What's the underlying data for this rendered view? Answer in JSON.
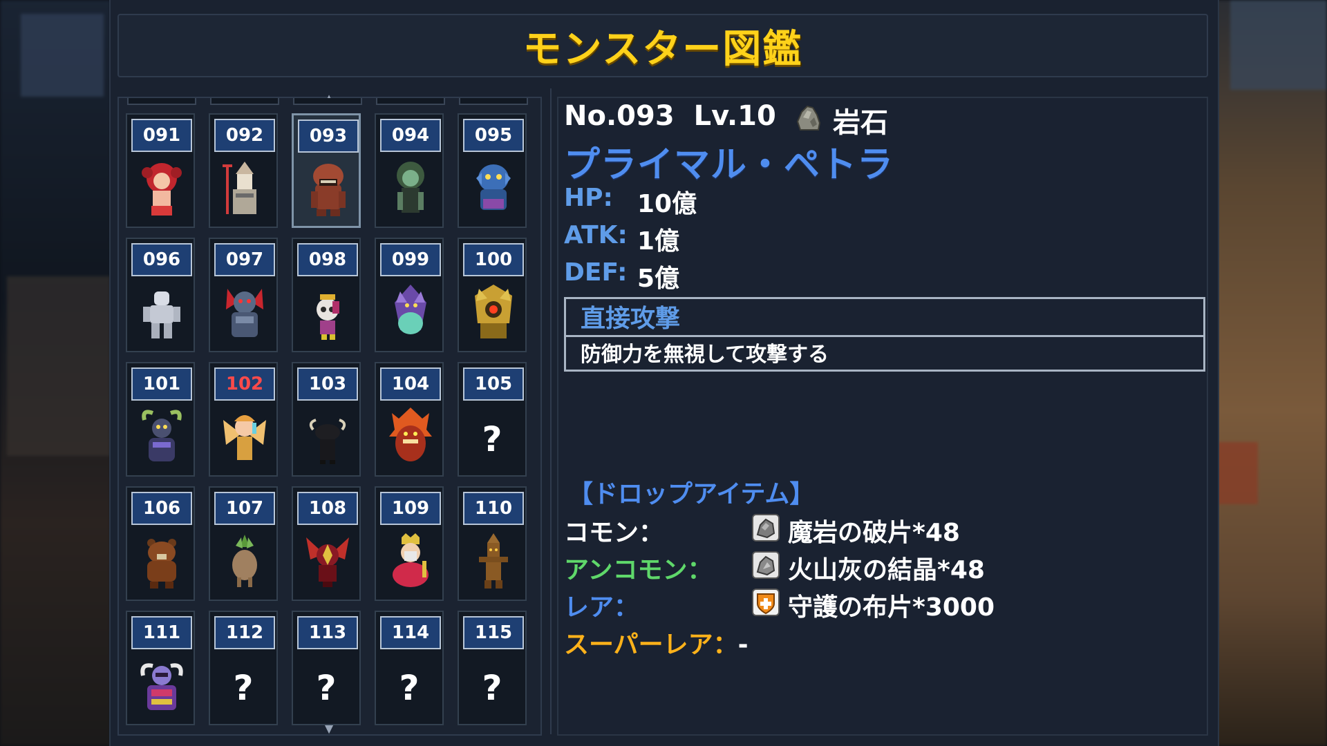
{
  "title": "モンスター図鑑",
  "grid": {
    "cells": [
      {
        "num": "091",
        "known": true,
        "red": false,
        "sprite": "red-haired-girl"
      },
      {
        "num": "092",
        "known": true,
        "red": false,
        "sprite": "trident-knight"
      },
      {
        "num": "093",
        "known": true,
        "red": false,
        "sprite": "rock-golem",
        "selected": true
      },
      {
        "num": "094",
        "known": true,
        "red": false,
        "sprite": "green-lady"
      },
      {
        "num": "095",
        "known": true,
        "red": false,
        "sprite": "blue-fish-man"
      },
      {
        "num": "096",
        "known": true,
        "red": false,
        "sprite": "white-golem"
      },
      {
        "num": "097",
        "known": true,
        "red": false,
        "sprite": "demon-red-hair"
      },
      {
        "num": "098",
        "known": true,
        "red": false,
        "sprite": "skull-girl"
      },
      {
        "num": "099",
        "known": true,
        "red": false,
        "sprite": "purple-dragon"
      },
      {
        "num": "100",
        "known": true,
        "red": false,
        "sprite": "golden-beast"
      },
      {
        "num": "101",
        "known": true,
        "red": false,
        "sprite": "horned-witch"
      },
      {
        "num": "102",
        "known": true,
        "red": true,
        "sprite": "winged-angel"
      },
      {
        "num": "103",
        "known": true,
        "red": false,
        "sprite": "black-bull"
      },
      {
        "num": "104",
        "known": true,
        "red": false,
        "sprite": "fire-demon"
      },
      {
        "num": "105",
        "known": false,
        "red": false,
        "sprite": ""
      },
      {
        "num": "106",
        "known": true,
        "red": false,
        "sprite": "brown-bear"
      },
      {
        "num": "107",
        "known": true,
        "red": false,
        "sprite": "mandrake"
      },
      {
        "num": "108",
        "known": true,
        "red": false,
        "sprite": "red-spider"
      },
      {
        "num": "109",
        "known": true,
        "red": false,
        "sprite": "crowned-king"
      },
      {
        "num": "110",
        "known": true,
        "red": false,
        "sprite": "wood-totem"
      },
      {
        "num": "111",
        "known": true,
        "red": false,
        "sprite": "horned-knight"
      },
      {
        "num": "112",
        "known": false,
        "red": false,
        "sprite": ""
      },
      {
        "num": "113",
        "known": false,
        "red": false,
        "sprite": ""
      },
      {
        "num": "114",
        "known": false,
        "red": false,
        "sprite": ""
      },
      {
        "num": "115",
        "known": false,
        "red": false,
        "sprite": ""
      }
    ],
    "unknown_mark": "?"
  },
  "detail": {
    "number": "No.093",
    "level": "Lv.10",
    "element_icon": "rock-icon",
    "element": "岩石",
    "name": "プライマル・ペトラ",
    "stats": [
      {
        "label": "HP:",
        "value": "10億"
      },
      {
        "label": "ATK:",
        "value": "1億"
      },
      {
        "label": "DEF:",
        "value": "5億"
      }
    ],
    "skill": {
      "name": "直接攻撃",
      "description": "防御力を無視して攻撃する"
    },
    "drops_header": "【ドロップアイテム】",
    "drops": [
      {
        "rarity": "コモン：",
        "color": "#ffffff",
        "icon": "rock-shard-icon",
        "item": "魔岩の破片*48"
      },
      {
        "rarity": "アンコモン：",
        "color": "#5fd86a",
        "icon": "rock-crystal-icon",
        "item": "火山灰の結晶*48"
      },
      {
        "rarity": "レア：",
        "color": "#4f8df0",
        "icon": "shield-cloth-icon",
        "item": "守護の布片*3000"
      },
      {
        "rarity": "スーパーレア：",
        "color": "#ffb21a",
        "icon": "",
        "item": "-"
      }
    ]
  }
}
